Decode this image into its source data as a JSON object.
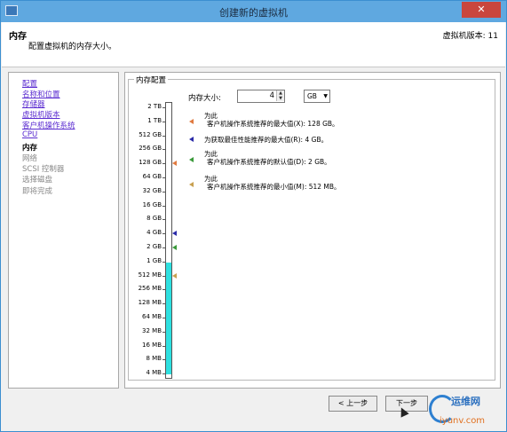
{
  "window": {
    "title": "创建新的虚拟机",
    "close_glyph": "✕"
  },
  "header": {
    "title": "内存",
    "subtitle": "配置虚拟机的内存大小。",
    "version": "虚拟机版本: 11"
  },
  "nav": {
    "items": [
      {
        "label": "配置",
        "state": "link"
      },
      {
        "label": "名称和位置",
        "state": "link"
      },
      {
        "label": "存储器",
        "state": "link"
      },
      {
        "label": "虚拟机版本",
        "state": "link"
      },
      {
        "label": "客户机操作系统",
        "state": "link"
      },
      {
        "label": "CPU",
        "state": "link"
      },
      {
        "label": "内存",
        "state": "current"
      },
      {
        "label": "网络",
        "state": "disabled"
      },
      {
        "label": "SCSI 控制器",
        "state": "disabled"
      },
      {
        "label": "选择磁盘",
        "state": "disabled"
      },
      {
        "label": "即将完成",
        "state": "disabled"
      }
    ]
  },
  "memory": {
    "group_title": "内存配置",
    "size_label": "内存大小:",
    "size_value": "4",
    "unit": "GB",
    "scale_ticks": [
      "2 TB",
      "1 TB",
      "512 GB",
      "256 GB",
      "128 GB",
      "64 GB",
      "32 GB",
      "16 GB",
      "8 GB",
      "4 GB",
      "2 GB",
      "1 GB",
      "512 MB",
      "256 MB",
      "128 MB",
      "64 MB",
      "32 MB",
      "16 MB",
      "8 MB",
      "4 MB"
    ],
    "fill_from_tick": "1 GB",
    "fill_color": "#2ee0e0",
    "legend": [
      {
        "line1": "为此",
        "line2": "客户机操作系统推荐的最大值(X): 128 GB。",
        "color": "#e07a40",
        "tick": "128 GB"
      },
      {
        "line1": "",
        "line2": "为获取最佳性能推荐的最大值(R): 4 GB。",
        "color": "#2b2ba8",
        "tick": "4 GB"
      },
      {
        "line1": "为此",
        "line2": "客户机操作系统推荐的默认值(D): 2 GB。",
        "color": "#3a9a3a",
        "tick": "2 GB"
      },
      {
        "line1": "为此",
        "line2": "客户机操作系统推荐的最小值(M): 512 MB。",
        "color": "#c8a050",
        "tick": "512 MB"
      }
    ]
  },
  "buttons": {
    "back": "< 上一步",
    "next": "下一步"
  },
  "watermark": {
    "top": "运维网",
    "bottom": "iyunv.com"
  }
}
